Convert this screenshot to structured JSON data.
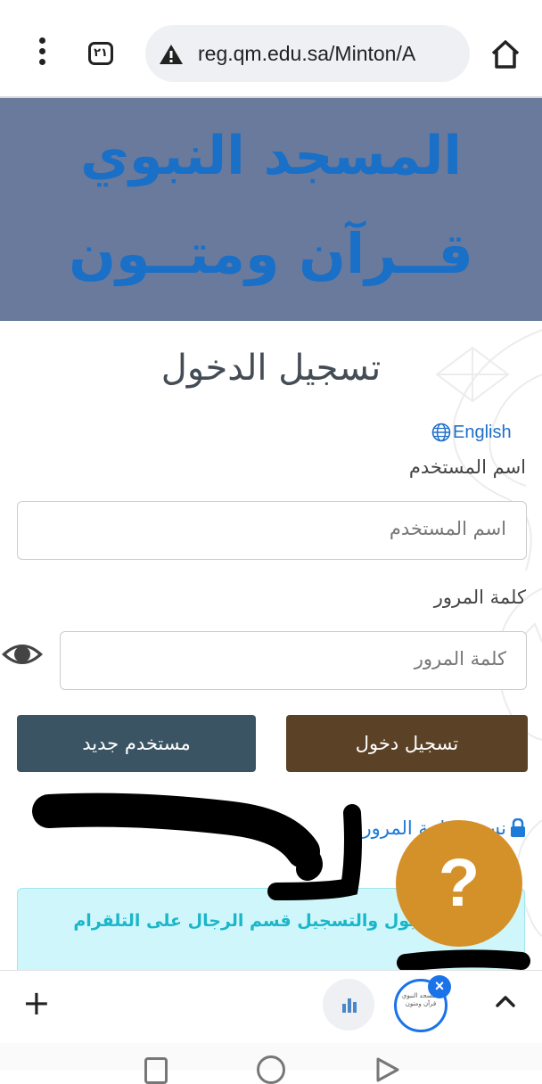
{
  "browser": {
    "tab_count": "٢١",
    "url": "reg.qm.edu.sa/Minton/A"
  },
  "banner": {
    "line1": "المسجد النبوي",
    "line2": "قــرآن ومتــون"
  },
  "page": {
    "title": "تسجيل الدخول",
    "language_link": "English"
  },
  "form": {
    "username_label": "اسم المستخدم",
    "username_placeholder": "اسم المستخدم",
    "password_label": "كلمة المرور",
    "password_placeholder": "كلمة المرور",
    "login_button": "تسجيل دخول",
    "new_user_button": "مستخدم جديد",
    "forgot_password": "نسيت كلمة المرور"
  },
  "notice": {
    "text": "مع القبول والتسجيل قسم الرجال على التلقرام"
  },
  "help": {
    "label": "?"
  },
  "bottom_bar": {
    "plus": "+",
    "thumb_text": "المسجد النبوي قرآن ومتون"
  },
  "colors": {
    "banner_bg": "#6a7a9c",
    "banner_text": "#1a6fc7",
    "login_button": "#5b4126",
    "new_user_button": "#3b5464",
    "help_button": "#d4912a",
    "link": "#1f6fc8",
    "notice_bg": "#cff7fb",
    "notice_text": "#1bb6c9"
  },
  "icons": {
    "menu": "more-vert-icon",
    "warning": "warning-triangle-icon",
    "home": "home-icon",
    "globe": "globe-icon",
    "eye": "eye-icon",
    "lock": "lock-icon",
    "chevron": "chevron-up-icon"
  }
}
